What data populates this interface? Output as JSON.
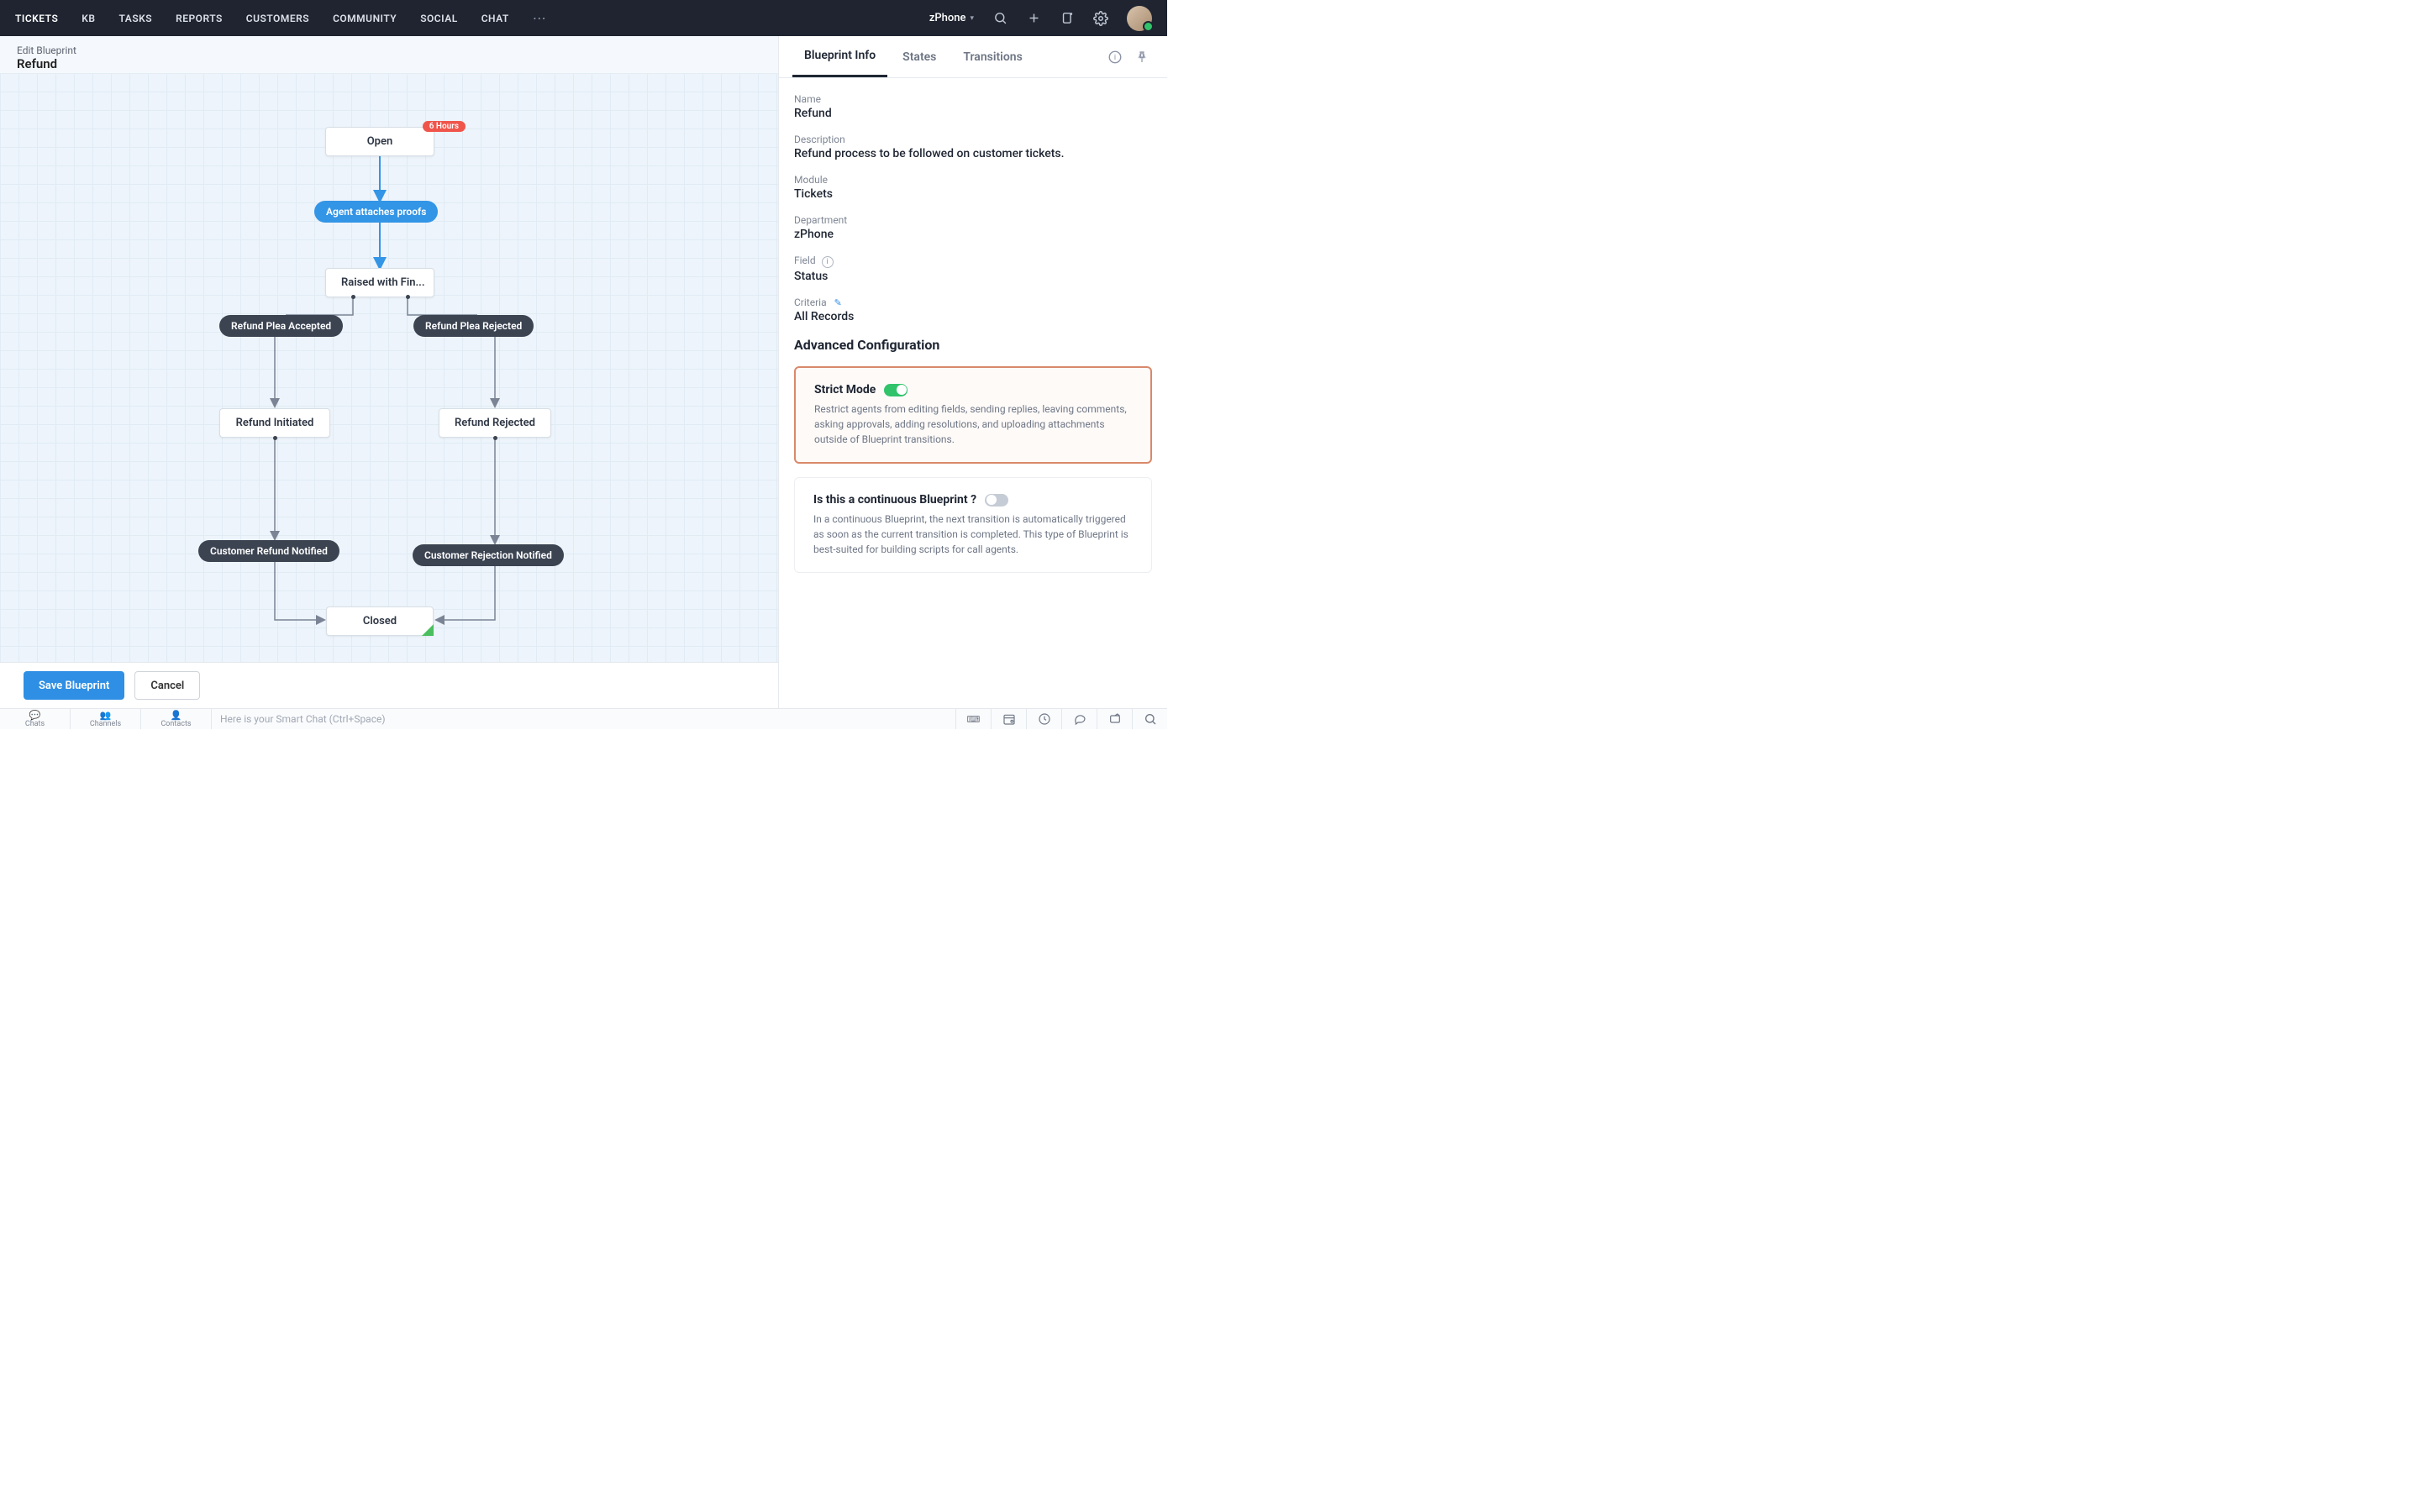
{
  "nav": {
    "items": [
      "TICKETS",
      "KB",
      "TASKS",
      "REPORTS",
      "CUSTOMERS",
      "COMMUNITY",
      "SOCIAL",
      "CHAT"
    ],
    "brand": "zPhone"
  },
  "crumb": {
    "pre": "Edit Blueprint",
    "title": "Refund"
  },
  "flow": {
    "open": "Open",
    "open_badge": "6 Hours",
    "t_attach": "Agent attaches proofs",
    "raised": "Raised with Fin...",
    "t_accept": "Refund Plea Accepted",
    "t_reject": "Refund Plea Rejected",
    "initiated": "Refund Initiated",
    "rejected": "Refund Rejected",
    "t_cust_ref": "Customer Refund Notified",
    "t_cust_rej": "Customer Rejection Notified",
    "closed": "Closed"
  },
  "actions": {
    "save": "Save Blueprint",
    "cancel": "Cancel"
  },
  "panel": {
    "tabs": [
      "Blueprint Info",
      "States",
      "Transitions"
    ],
    "fields": {
      "name_label": "Name",
      "name_value": "Refund",
      "desc_label": "Description",
      "desc_value": "Refund process to be followed on customer tickets.",
      "module_label": "Module",
      "module_value": "Tickets",
      "dept_label": "Department",
      "dept_value": "zPhone",
      "field_label": "Field",
      "field_value": "Status",
      "criteria_label": "Criteria",
      "criteria_value": "All Records"
    },
    "adv_title": "Advanced Configuration",
    "strict": {
      "title": "Strict Mode",
      "desc": "Restrict agents from editing fields, sending replies, leaving comments, asking approvals, adding resolutions, and uploading attachments outside of Blueprint transitions."
    },
    "continuous": {
      "title": "Is this a continuous Blueprint ?",
      "desc": "In a continuous Blueprint, the next transition is automatically triggered as soon as the current transition is completed. This type of Blueprint is best-suited for building scripts for call agents."
    }
  },
  "dock": {
    "tabs": [
      "Chats",
      "Channels",
      "Contacts"
    ],
    "smart": "Here is your Smart Chat (Ctrl+Space)"
  }
}
